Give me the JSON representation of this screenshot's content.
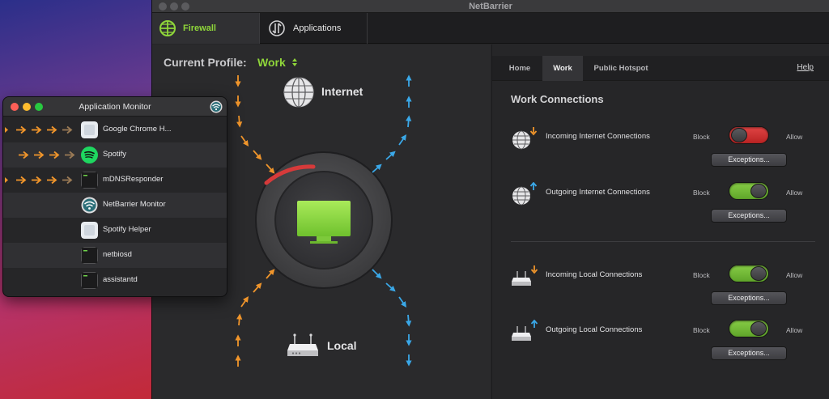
{
  "main_window": {
    "title": "NetBarrier",
    "toolbar_tabs": [
      {
        "label": "Firewall",
        "active": true,
        "icon": "firewall-globe-icon"
      },
      {
        "label": "Applications",
        "active": false,
        "icon": "applications-icon"
      }
    ],
    "profile": {
      "label": "Current Profile:",
      "value": "Work"
    },
    "scene": {
      "internet_label": "Internet",
      "local_label": "Local"
    },
    "tabs": [
      {
        "label": "Home",
        "active": false
      },
      {
        "label": "Work",
        "active": true
      },
      {
        "label": "Public Hotspot",
        "active": false
      }
    ],
    "help_label": "Help",
    "section_title": "Work Connections",
    "connections": [
      {
        "label": "Incoming Internet Connections",
        "state": "block",
        "icon": "globe-incoming-icon"
      },
      {
        "label": "Outgoing Internet Connections",
        "state": "allow",
        "icon": "globe-outgoing-icon"
      },
      {
        "label": "Incoming Local Connections",
        "state": "allow",
        "icon": "router-incoming-icon"
      },
      {
        "label": "Outgoing Local Connections",
        "state": "allow",
        "icon": "router-outgoing-icon"
      }
    ],
    "block_label": "Block",
    "allow_label": "Allow",
    "exceptions_label": "Exceptions..."
  },
  "app_monitor": {
    "title": "Application Monitor",
    "apps": [
      {
        "name": "Google Chrome H...",
        "icon": "generic-app-icon",
        "active_arrows": 4
      },
      {
        "name": "Spotify",
        "icon": "spotify-icon",
        "active_arrows": 4
      },
      {
        "name": "mDNSResponder",
        "icon": "terminal-icon",
        "active_arrows": 4
      },
      {
        "name": "NetBarrier Monitor",
        "icon": "netbarrier-icon",
        "active_arrows": 0
      },
      {
        "name": "Spotify Helper",
        "icon": "generic-app-icon",
        "active_arrows": 0
      },
      {
        "name": "netbiosd",
        "icon": "terminal-icon",
        "active_arrows": 0
      },
      {
        "name": "assistantd",
        "icon": "terminal-icon",
        "active_arrows": 0
      }
    ]
  },
  "colors": {
    "accent_green": "#8fd63a",
    "block_red": "#d63a3a",
    "incoming_orange": "#f0952b",
    "outgoing_blue": "#3aa8e8"
  }
}
